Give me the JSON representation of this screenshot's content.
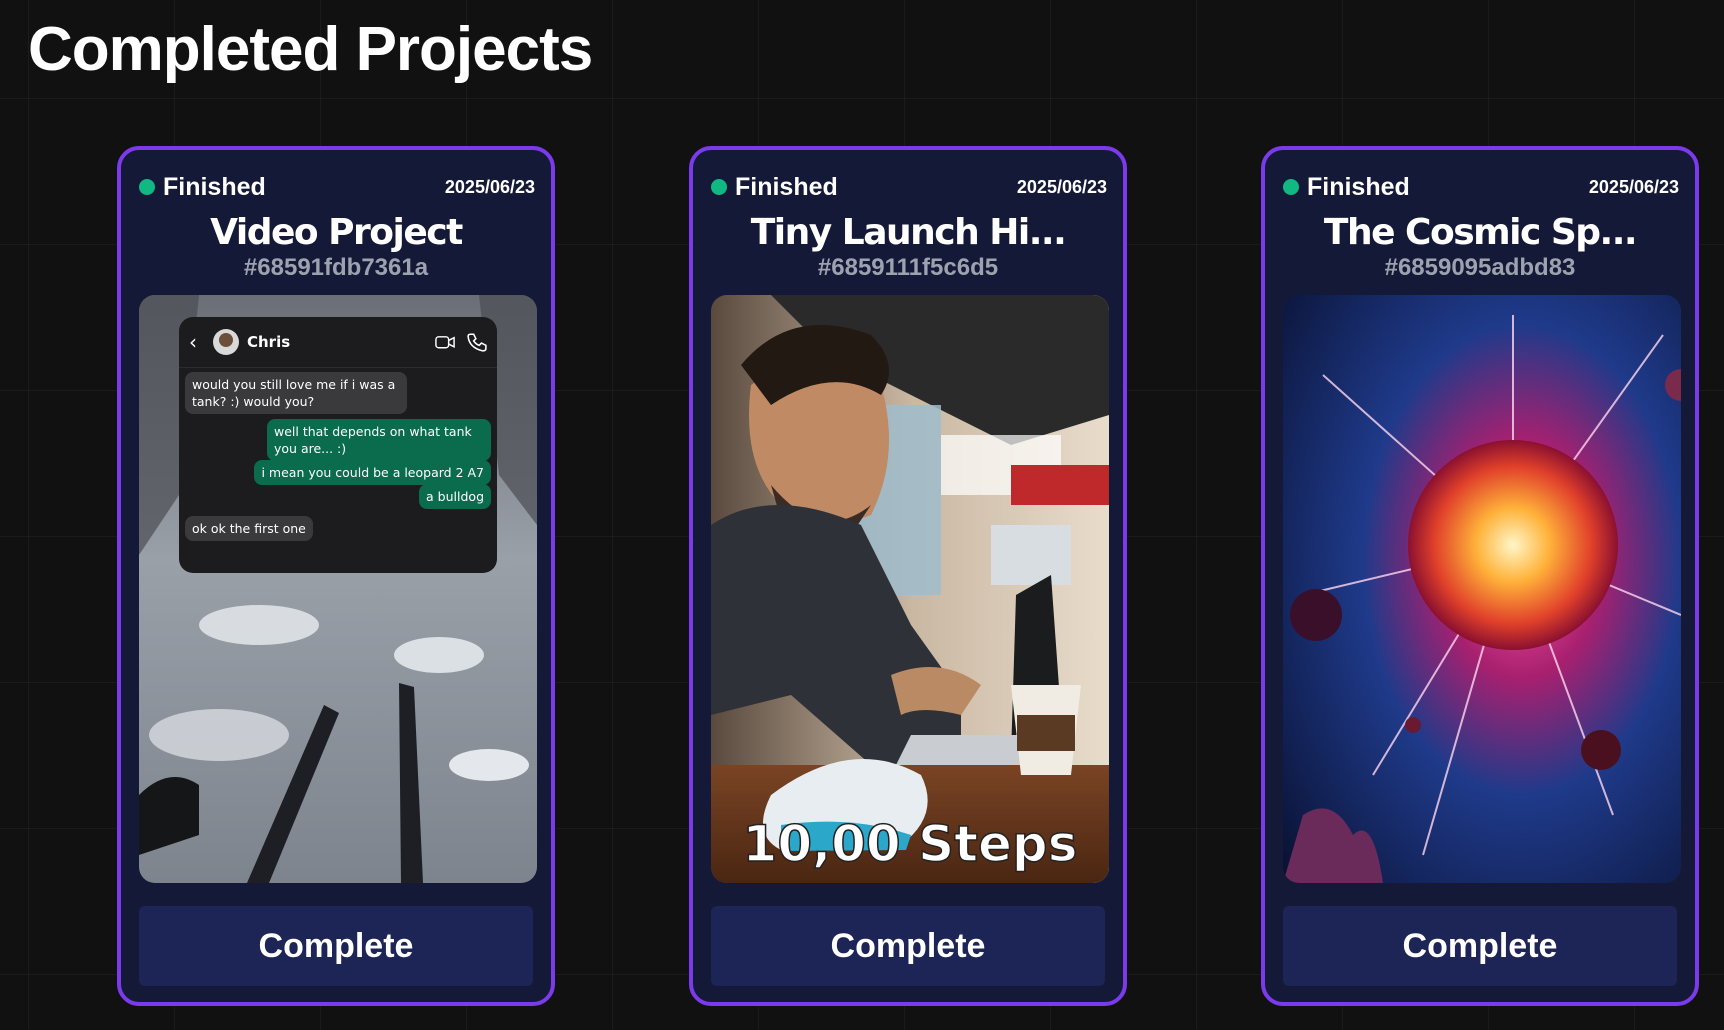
{
  "page": {
    "title": "Completed Projects"
  },
  "projects": [
    {
      "status": "Finished",
      "date": "2025/06/23",
      "title": "Video Project",
      "id": "#68591fdb7361a",
      "button": "Complete",
      "thumbnail": "skiing-video-with-chat-overlay",
      "chat": {
        "contact": "Chris",
        "messages": [
          {
            "from": "them",
            "text": "would you still love me if i was a tank? :) would you?"
          },
          {
            "from": "me",
            "text": "well that depends on what tank you are... :)"
          },
          {
            "from": "me",
            "text": "i mean you could be a leopard 2 A7"
          },
          {
            "from": "me",
            "text": "a bulldog"
          },
          {
            "from": "them",
            "text": "ok ok the first one"
          }
        ]
      }
    },
    {
      "status": "Finished",
      "date": "2025/06/23",
      "title": "Tiny Launch Hi...",
      "id": "#6859111f5c6d5",
      "button": "Complete",
      "thumbnail": "man-laughing-at-laptop-in-cafe",
      "caption": "10,00  Steps"
    },
    {
      "status": "Finished",
      "date": "2025/06/23",
      "title": "The Cosmic Sp...",
      "id": "#6859095adbd83",
      "button": "Complete",
      "thumbnail": "cosmic-explosion"
    }
  ],
  "colors": {
    "background": "#111111",
    "card_border": "#7c3aed",
    "card_bg": "#151938",
    "status_dot": "#10b981",
    "button_bg": "#1d2456",
    "id_text": "#9ca3af"
  }
}
